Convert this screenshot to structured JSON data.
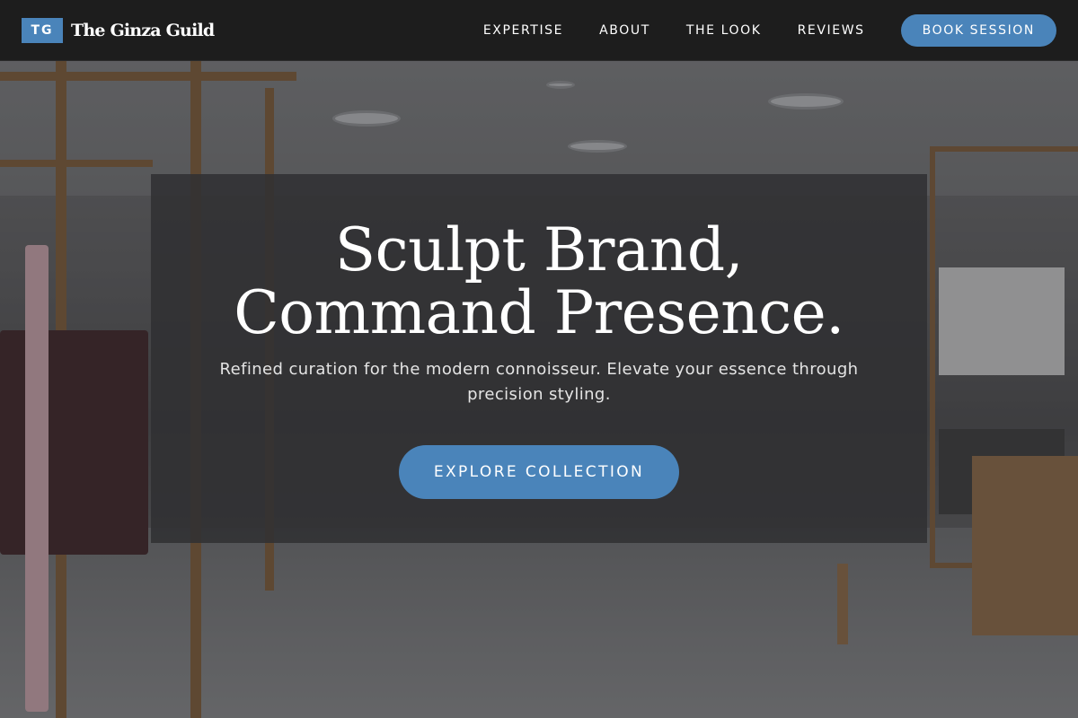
{
  "brand": {
    "logo_text": "TG",
    "name": "The Ginza Guild"
  },
  "nav": {
    "links": [
      "EXPERTISE",
      "ABOUT",
      "THE LOOK",
      "REVIEWS"
    ],
    "cta_label": "BOOK SESSION"
  },
  "hero": {
    "title_line1": "Sculpt Brand,",
    "title_line2": "Command Presence.",
    "subtitle": "Refined curation for the modern connoisseur. Elevate your essence through precision styling.",
    "cta_label": "EXPLORE COLLECTION",
    "background": "store-interior-photo"
  },
  "colors": {
    "accent": "#4a84ba",
    "navbar": "#1d1d1d",
    "card_overlay": "#303032"
  }
}
